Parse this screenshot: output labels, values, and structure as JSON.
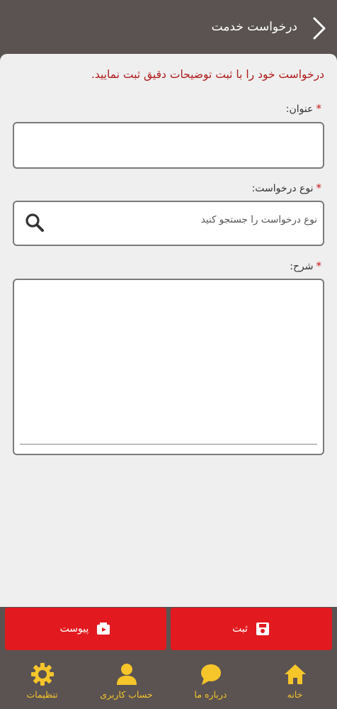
{
  "header": {
    "title": "درخواست خدمت",
    "back_icon": "chevron-right-icon"
  },
  "form": {
    "intro": "درخواست خود را با ثبت توضیحات دقیق ثبت نمایید.",
    "required_mark": "*",
    "title_label": "عنوان:",
    "title_value": "",
    "type_label": "نوع درخواست:",
    "type_placeholder": "نوع درخواست را جستجو کنید",
    "type_icon": "search-icon",
    "description_label": "شرح:",
    "description_value": ""
  },
  "actions": {
    "submit_label": "ثبت",
    "submit_icon": "save-icon",
    "attach_label": "پیوست",
    "attach_icon": "attachment-icon"
  },
  "navbar": {
    "items": [
      {
        "label": "خانه",
        "icon": "home-icon"
      },
      {
        "label": "درباره ما",
        "icon": "chat-bubble-icon"
      },
      {
        "label": "حساب کاربری",
        "icon": "user-icon"
      },
      {
        "label": "تنظیمات",
        "icon": "gear-icon"
      }
    ]
  },
  "colors": {
    "header_bg": "#5b5351",
    "content_bg": "#efefef",
    "accent_red": "#e21a1f",
    "intro_red": "#b01a1a",
    "nav_yellow": "#f6c52a"
  }
}
